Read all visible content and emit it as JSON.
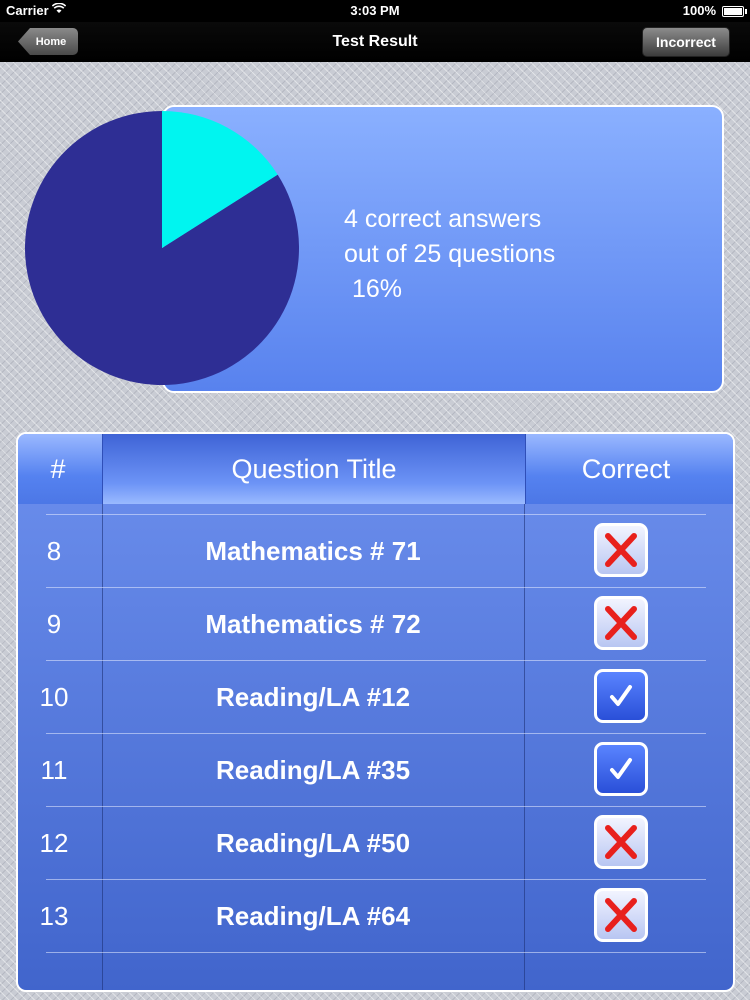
{
  "status_bar": {
    "carrier": "Carrier",
    "time": "3:03 PM",
    "battery": "100%"
  },
  "nav": {
    "title": "Test Result",
    "back_label": "Home",
    "right_label": "Incorrect"
  },
  "summary": {
    "line1": "4 correct answers",
    "line2": "out of 25 questions",
    "line3": "16%",
    "correct": 4,
    "total": 25,
    "colors": {
      "correct": "#00f5f0",
      "incorrect": "#2e2e94"
    }
  },
  "chart_data": {
    "type": "pie",
    "slices": [
      {
        "name": "correct",
        "value": 4,
        "color": "#00f5f0"
      },
      {
        "name": "incorrect",
        "value": 21,
        "color": "#2e2e94"
      }
    ]
  },
  "table": {
    "headers": {
      "num": "#",
      "title": "Question Title",
      "correct": "Correct"
    },
    "rows": [
      {
        "num": "8",
        "title": "Mathematics # 71",
        "correct": false
      },
      {
        "num": "9",
        "title": "Mathematics # 72",
        "correct": false
      },
      {
        "num": "10",
        "title": "Reading/LA #12",
        "correct": true
      },
      {
        "num": "11",
        "title": "Reading/LA #35",
        "correct": true
      },
      {
        "num": "12",
        "title": "Reading/LA #50",
        "correct": false
      },
      {
        "num": "13",
        "title": "Reading/LA #64",
        "correct": false
      }
    ]
  }
}
